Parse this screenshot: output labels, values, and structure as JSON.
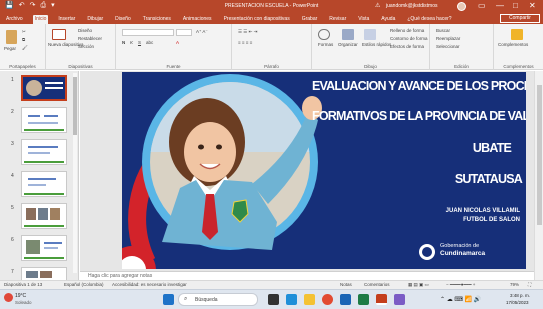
{
  "window": {
    "title": "PRESENTACION ESCUELA - PowerPoint",
    "account": "juandomk@jkstdistmos",
    "controls": [
      "—",
      "□",
      "✕"
    ],
    "quick_access": [
      "💾",
      "↶",
      "↷",
      "⎙",
      "▾"
    ]
  },
  "tabs": [
    {
      "label": "Archivo"
    },
    {
      "label": "Inicio"
    },
    {
      "label": "Insertar"
    },
    {
      "label": "Dibujar"
    },
    {
      "label": "Diseño"
    },
    {
      "label": "Transiciones"
    },
    {
      "label": "Animaciones"
    },
    {
      "label": "Presentación con diapositivas"
    },
    {
      "label": "Grabar"
    },
    {
      "label": "Revisar"
    },
    {
      "label": "Vista"
    },
    {
      "label": "Ayuda"
    },
    {
      "label": "¿Qué desea hacer?"
    }
  ],
  "share_label": "Compartir",
  "ribbon": {
    "groups": {
      "portapapeles": "Portapapeles",
      "diapositivas": "Diapositivas",
      "fuente": "Fuente",
      "parrafo": "Párrafo",
      "dibujo": "Dibujo",
      "edicion": "Edición",
      "complementos": "Complementos"
    },
    "pegar": "Pegar",
    "nueva_diapositiva": "Nueva diapositiva",
    "diseno": "Diseño",
    "restablecer": "Restablecer",
    "seccion": "Sección",
    "formas": "Formas",
    "organizar": "Organizar",
    "estilos_rapidos": "Estilos rápidos",
    "relleno": "Relleno de forma",
    "contorno": "Contorno de forma",
    "efectos": "Efectos de forma",
    "buscar": "Buscar",
    "reemplazar": "Reemplazar",
    "seleccionar": "Seleccionar",
    "complementos_btn": "Complementos"
  },
  "thumbnails": [
    {
      "num": "1"
    },
    {
      "num": "2"
    },
    {
      "num": "3"
    },
    {
      "num": "4"
    },
    {
      "num": "5"
    },
    {
      "num": "6"
    },
    {
      "num": "7"
    }
  ],
  "slide": {
    "title_lines": [
      "EVALUACION Y AVANCE DE LOS PROCESOS",
      "FORMATIVOS DE LA PROVINCIA DE VALLE DE",
      "UBATE",
      "SUTATAUSA"
    ],
    "subtitle_lines": [
      "JUAN NICOLAS VILLAMIL",
      "FUTBOL DE SALON"
    ],
    "logo_lines": [
      "Gobernación de",
      "Cundinamarca"
    ],
    "colors": {
      "background": "#162f79",
      "accent": "#d3232a"
    }
  },
  "notes_placeholder": "Haga clic para agregar notas",
  "status": {
    "slide_counter": "Diapositiva 1 de 13",
    "language": "Español (Colombia)",
    "accessibility": "Accesibilidad: es necesario investigar",
    "notes": "Notas",
    "comments": "Comentarios",
    "zoom": "79%"
  },
  "taskbar": {
    "weather_temp": "19°C",
    "weather_text": "Soleado",
    "search_placeholder": "Búsqueda",
    "time": "3:48 p. m.",
    "date": "17/05/2023"
  }
}
